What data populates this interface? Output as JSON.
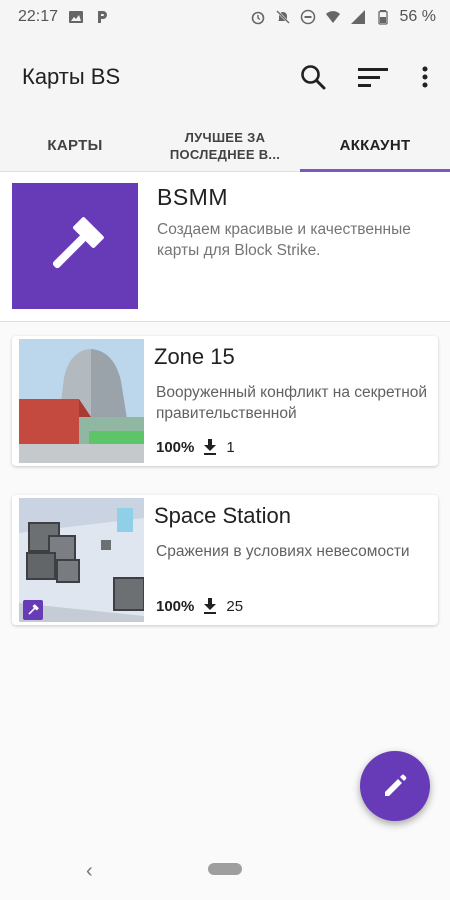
{
  "status_bar": {
    "time": "22:17",
    "battery": "56 %"
  },
  "app_bar": {
    "title": "Карты BS",
    "icons": [
      "search-icon",
      "sort-icon",
      "more-vert-icon"
    ]
  },
  "tabs": [
    {
      "label": "КАРТЫ"
    },
    {
      "label": "ЛУЧШЕЕ ЗА ПОСЛЕДНЕЕ В..."
    },
    {
      "label": "АККАУНТ"
    }
  ],
  "account": {
    "name": "BSMM",
    "description": "Создаем красивые и качественные карты для Block Strike.",
    "logo_color": "#673ab7"
  },
  "maps": [
    {
      "title": "Zone 15",
      "description": "Вооруженный конфликт на секретной правительственной",
      "rating": "100%",
      "downloads": "1"
    },
    {
      "title": "Space Station",
      "description": "Сражения в условиях невесомости",
      "rating": "100%",
      "downloads": "25"
    }
  ],
  "colors": {
    "accent": "#673ab7",
    "tab_indicator": "#7e57c2"
  }
}
